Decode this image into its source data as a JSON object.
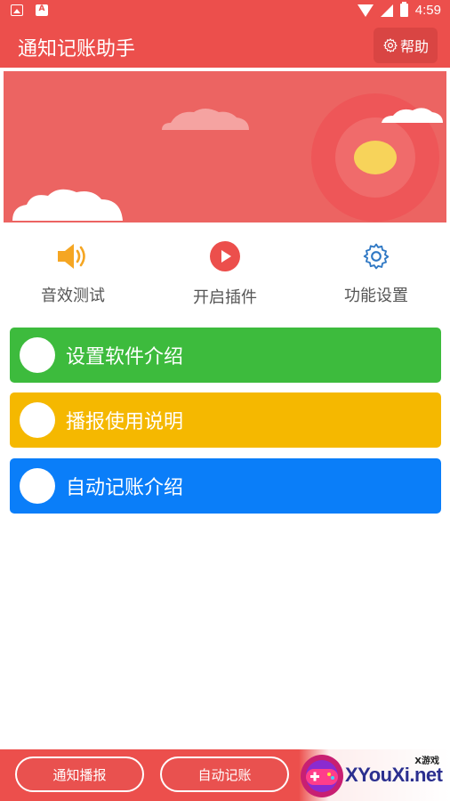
{
  "status_bar": {
    "time": "4:59"
  },
  "app_bar": {
    "title": "通知记账助手",
    "help_label": "帮助"
  },
  "quick_actions": [
    {
      "label": "音效测试",
      "icon": "speaker-icon"
    },
    {
      "label": "开启插件",
      "icon": "play-icon"
    },
    {
      "label": "功能设置",
      "icon": "gear-icon"
    }
  ],
  "cards": [
    {
      "label": "设置软件介绍",
      "color": "#3dbb3d"
    },
    {
      "label": "播报使用说明",
      "color": "#f5b800"
    },
    {
      "label": "自动记账介绍",
      "color": "#0a7ef9"
    }
  ],
  "bottom_bar": {
    "button_1": "通知播报",
    "button_2": "自动记账"
  },
  "watermark": {
    "small_text": "X游戏",
    "brand": "XYouXi.net"
  },
  "colors": {
    "primary": "#ec4f4c",
    "banner": "#ec6462",
    "green": "#3dbb3d",
    "yellow": "#f5b800",
    "blue": "#0a7ef9"
  }
}
